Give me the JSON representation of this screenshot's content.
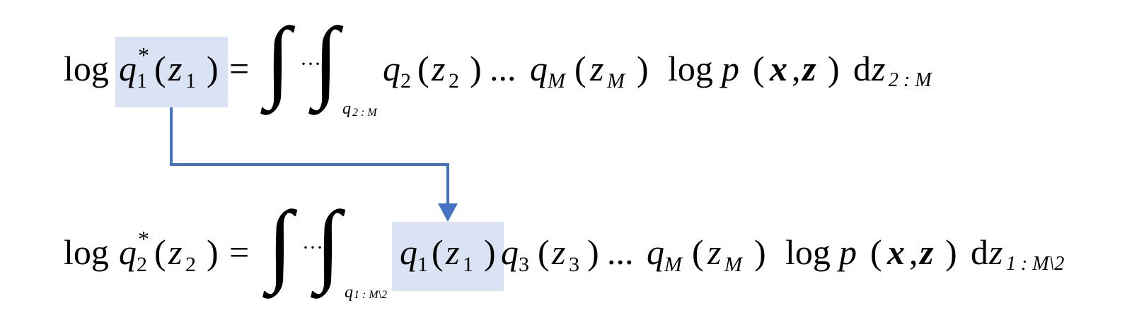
{
  "equations": {
    "eq1": {
      "lhs_func": "log",
      "lhs_q": "q",
      "lhs_q_sup": "*",
      "lhs_q_sub": "1",
      "lhs_arg": "z",
      "lhs_arg_sub": "1",
      "equals": "=",
      "integral_sign": "∫",
      "integral_dots": "···",
      "integral_sub_q": "q",
      "integral_sub_idx": "2 : M",
      "term1_q": "q",
      "term1_q_sub": "2",
      "term1_arg": "z",
      "term1_arg_sub": "2",
      "ellipsis": "...",
      "term2_q": "q",
      "term2_q_sub": "M",
      "term2_arg": "z",
      "term2_arg_sub": "M",
      "log_word": "log",
      "p": "p",
      "x": "x",
      "z": "z",
      "d": "d",
      "dz": "z",
      "dz_sub": "2 : M"
    },
    "eq2": {
      "lhs_func": "log",
      "lhs_q": "q",
      "lhs_q_sup": "*",
      "lhs_q_sub": "2",
      "lhs_arg": "z",
      "lhs_arg_sub": "2",
      "equals": "=",
      "integral_sign": "∫",
      "integral_dots": "···",
      "integral_sub_q": "q",
      "integral_sub_idx": "1 : M\\2",
      "term1_q": "q",
      "term1_q_sub": "1",
      "term1_arg": "z",
      "term1_arg_sub": "1",
      "term2_q": "q",
      "term2_q_sub": "3",
      "term2_arg": "z",
      "term2_arg_sub": "3",
      "ellipsis": "...",
      "term3_q": "q",
      "term3_q_sub": "M",
      "term3_arg": "z",
      "term3_arg_sub": "M",
      "log_word": "log",
      "p": "p",
      "x": "x",
      "z": "z",
      "d": "d",
      "dz": "z",
      "dz_sub": "1 : M\\2"
    }
  },
  "colors": {
    "highlight": "#dae3f3",
    "arrow": "#4472c4"
  }
}
